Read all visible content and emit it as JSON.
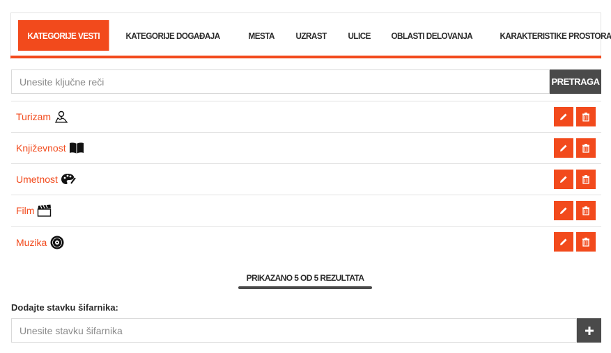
{
  "tabs": [
    {
      "label": "KATEGORIJE VESTI",
      "active": true
    },
    {
      "label": "KATEGORIJE DOGAĐAJA",
      "active": false
    },
    {
      "label": "MESTA",
      "active": false
    },
    {
      "label": "UZRAST",
      "active": false
    },
    {
      "label": "ULICE",
      "active": false
    },
    {
      "label": "OBLASTI DELOVANJA",
      "active": false
    },
    {
      "label": "KARAKTERISTIKE PROSTORA",
      "active": false
    }
  ],
  "search": {
    "placeholder": "Unesite ključne reči",
    "button_label": "PRETRAGA"
  },
  "items": [
    {
      "label": "Turizam",
      "icon": "map-icon"
    },
    {
      "label": "Književnost",
      "icon": "book-icon"
    },
    {
      "label": "Umetnost",
      "icon": "palette-icon"
    },
    {
      "label": "Film",
      "icon": "clapperboard-icon"
    },
    {
      "label": "Muzika",
      "icon": "vinyl-icon"
    }
  ],
  "pagination": {
    "text": "PRIKAZANO 5 OD 5 REZULTATA"
  },
  "add": {
    "label": "Dodajte stavku šifarnika:",
    "placeholder": "Unesite stavku šifarnika",
    "button_symbol": "+"
  },
  "colors": {
    "accent": "#f24a1c",
    "dark": "#4a4a4a"
  }
}
